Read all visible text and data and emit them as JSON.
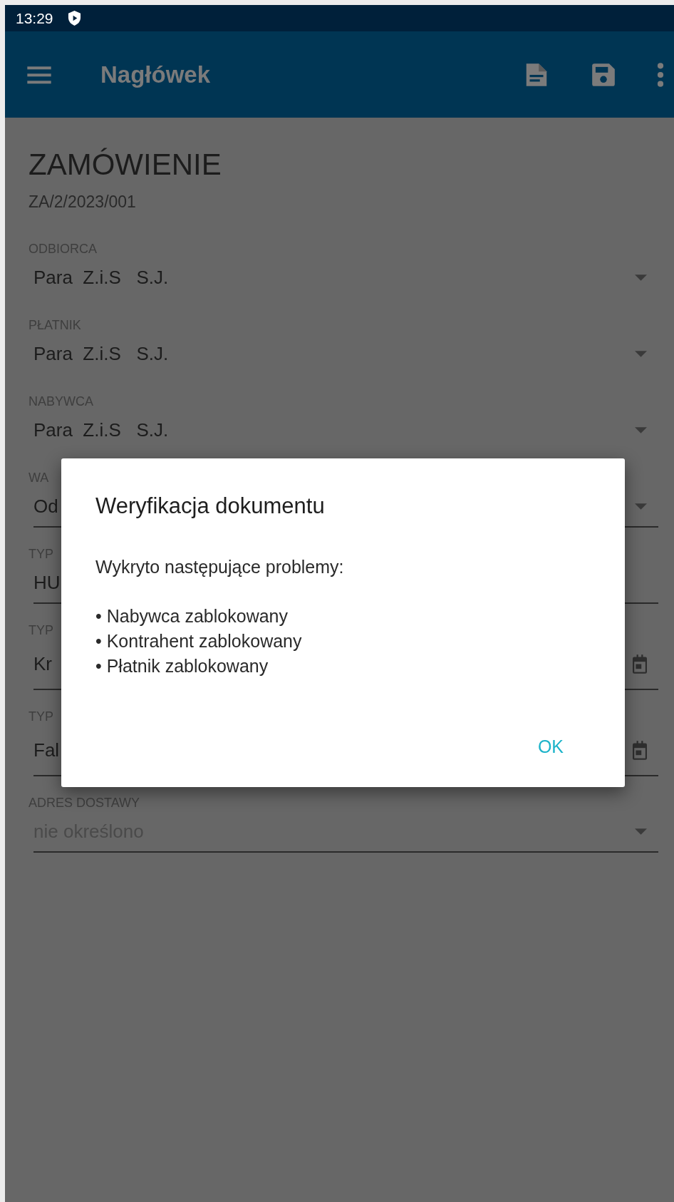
{
  "status_bar": {
    "time": "13:29"
  },
  "app_bar": {
    "title": "Nagłówek"
  },
  "document": {
    "title": "ZAMÓWIENIE",
    "number": "ZA/2/2023/001"
  },
  "fields": [
    {
      "label": "ODBIORCA",
      "value": "Para  Z.i.S   S.J.",
      "kind": "dropdown",
      "underlined": false
    },
    {
      "label": "PŁATNIK",
      "value": "Para  Z.i.S   S.J.",
      "kind": "dropdown",
      "underlined": false
    },
    {
      "label": "NABYWCA",
      "value": "Para  Z.i.S   S.J.",
      "kind": "dropdown",
      "underlined": false
    },
    {
      "label": "WA",
      "value": "Od",
      "kind": "dropdown",
      "underlined": true
    },
    {
      "label": "TYP",
      "value": "HU",
      "kind": "text",
      "underlined": true
    },
    {
      "label": "TYP",
      "value": "Kr",
      "kind": "date",
      "underlined": true
    },
    {
      "label": "TYP",
      "value": "Fal",
      "kind": "date",
      "underlined": true
    },
    {
      "label": "ADRES DOSTAWY",
      "placeholder": "nie określono",
      "kind": "dropdown",
      "underlined": true
    }
  ],
  "dialog": {
    "title": "Weryfikacja dokumentu",
    "message": "Wykryto następujące problemy:",
    "items": [
      "• Nabywca zablokowany",
      "• Kontrahent zablokowany",
      "• Płatnik zablokowany"
    ],
    "buttons": [
      "OK"
    ]
  }
}
